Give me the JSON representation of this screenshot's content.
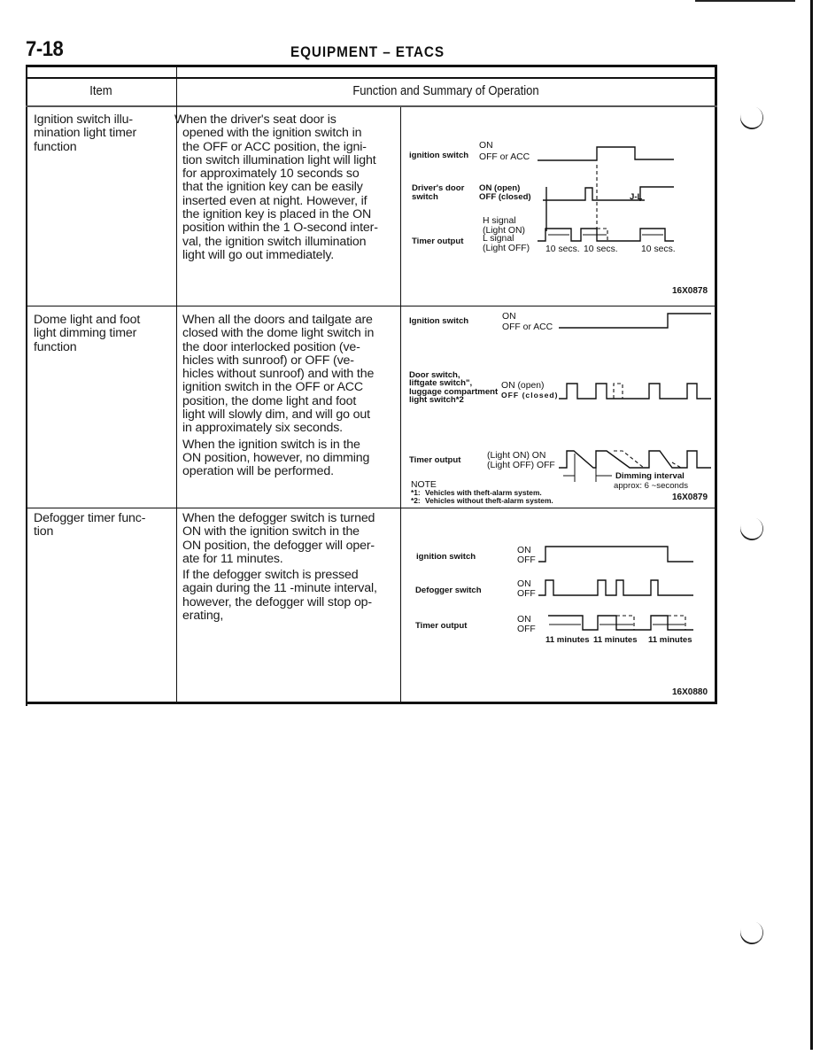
{
  "page": {
    "number": "7-18",
    "section_title": "EQUIPMENT – ETACS"
  },
  "table": {
    "headers": {
      "item": "Item",
      "function": "Function and Summary of Operation"
    },
    "rows": [
      {
        "item_lines": [
          "Ignition switch illu-",
          "mination light timer",
          "function"
        ],
        "summary_lines": [
          "When the driver's seat door is",
          "opened with the ignition switch in",
          "the OFF or ACC position, the igni-",
          "tion switch illumination light will light",
          "for approximately 10 seconds so",
          "that the ignition key can be easily",
          "inserted even at night. However, if",
          "the ignition key is placed in the ON",
          "position within the 1 O-second inter-",
          "val, the ignition switch illumination",
          "light will go out immediately."
        ],
        "diagram": {
          "code": "16X0878",
          "signals": [
            {
              "name": "ignition switch",
              "states": [
                "ON",
                "OFF or ACC"
              ]
            },
            {
              "name_lines": [
                "Driver's door",
                "switch"
              ],
              "states": [
                "ON (open)",
                "OFF (closed)"
              ],
              "note": "J-L"
            },
            {
              "name": "Timer output",
              "states": [
                "H signal",
                "(Light ON)",
                "L signal",
                "(Light OFF)"
              ]
            }
          ],
          "intervals": [
            "10 secs.",
            "10 secs.",
            "10 secs."
          ]
        }
      },
      {
        "item_lines": [
          "Dome light and foot",
          "light dimming timer",
          "function"
        ],
        "summary_lines": [
          "When all the doors and tailgate are",
          "closed with the dome light switch in",
          "the door interlocked position (ve-",
          "hicles with sunroof) or OFF (ve-",
          "hicles without sunroof) and with the",
          "ignition switch in the OFF or ACC",
          "position, the dome light and foot",
          "light will slowly dim, and will go out",
          "in approximately six seconds."
        ],
        "summary_lines_2": [
          "When the ignition switch is in the",
          "ON position, however, no dimming",
          "operation will be performed."
        ],
        "diagram": {
          "code": "16X0879",
          "signals": [
            {
              "name": "Ignition switch",
              "states": [
                "ON",
                "OFF or ACC"
              ]
            },
            {
              "name_lines": [
                "Door switch,",
                "liftgate switch\",",
                "luggage compartment",
                "light switch*2"
              ],
              "states": [
                "ON (open)",
                "OFF (closed)"
              ]
            },
            {
              "name": "Timer output",
              "states": [
                "(Light ON) ON",
                "(Light OFF) OFF"
              ]
            }
          ],
          "interval_label": "Dimming interval",
          "interval_value": "approx: 6 ~seconds",
          "note_title": "NOTE",
          "notes": [
            {
              "mark": "*1:",
              "text": "Vehicles with theft-alarm system."
            },
            {
              "mark": "*2:",
              "text": "Vehicles without theft-alarm system."
            }
          ]
        }
      },
      {
        "item_lines": [
          "Defogger timer func-",
          "tion"
        ],
        "summary_lines": [
          "When the defogger switch is turned",
          "ON with the ignition switch in the",
          "ON position, the defogger will oper-",
          "ate for 11 minutes."
        ],
        "summary_lines_2": [
          "If the defogger switch is pressed",
          "again during the 11 -minute interval,",
          "however, the defogger will stop op-",
          "erating,"
        ],
        "diagram": {
          "code": "16X0880",
          "signals": [
            {
              "name": "ignition switch",
              "states": [
                "ON",
                "OFF"
              ]
            },
            {
              "name": "Defogger switch",
              "states": [
                "ON",
                "OFF"
              ]
            },
            {
              "name": "Timer output",
              "states": [
                "ON",
                "OFF"
              ]
            }
          ],
          "intervals": [
            "11 minutes",
            "11 minutes",
            "11 minutes"
          ]
        }
      }
    ]
  }
}
